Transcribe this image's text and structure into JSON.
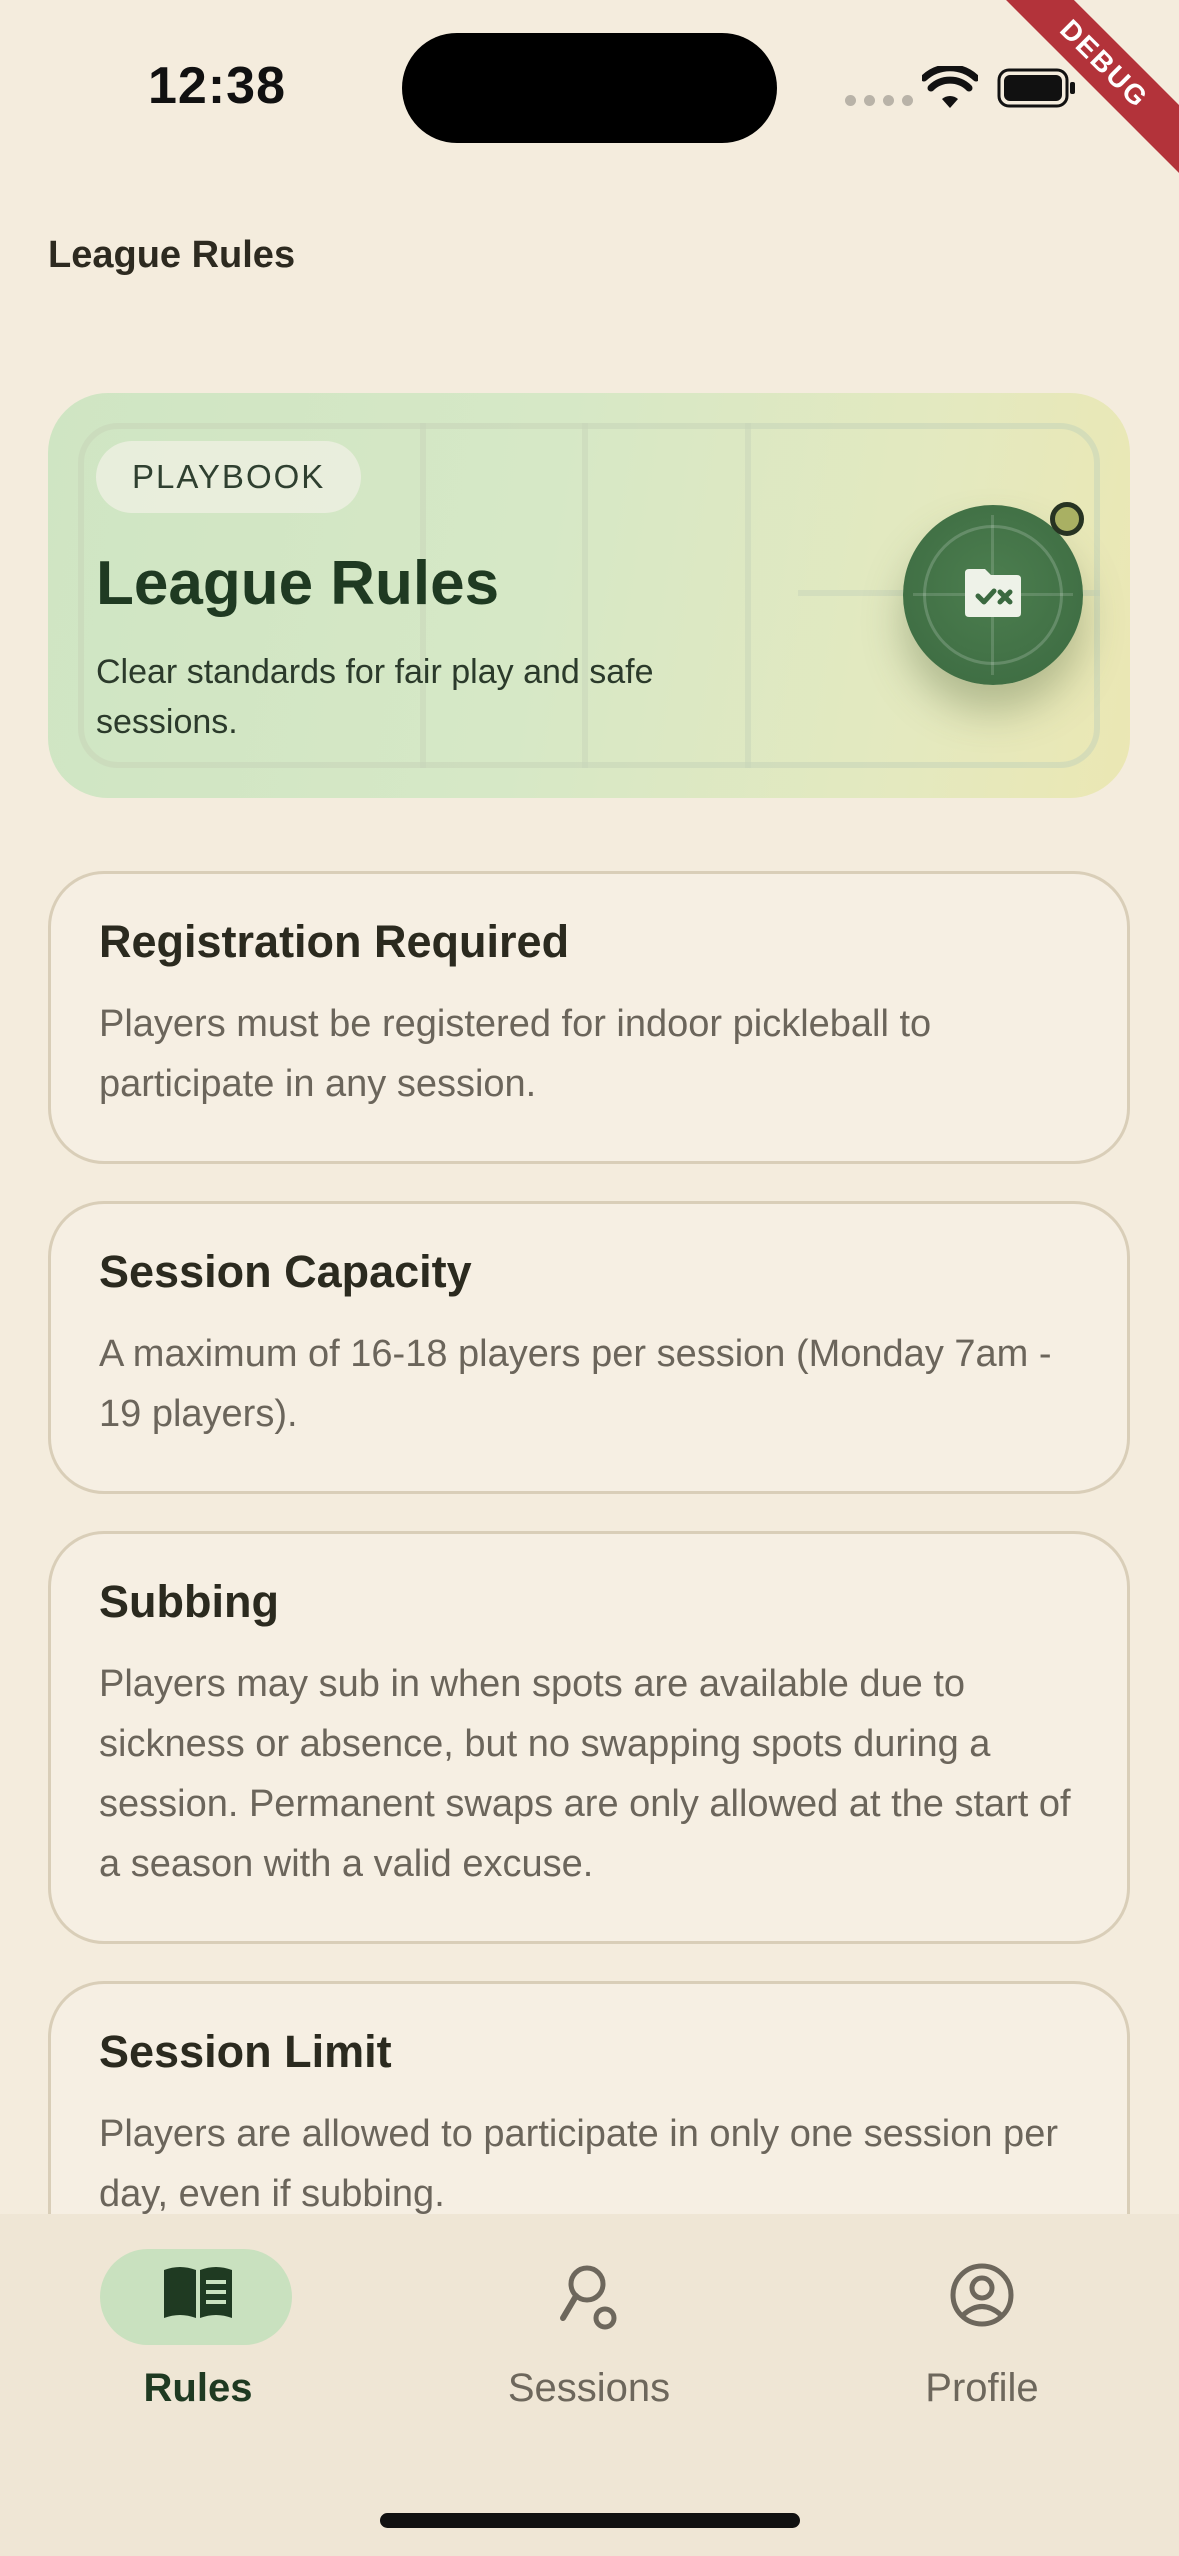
{
  "status_bar": {
    "time": "12:38"
  },
  "debug_banner": "DEBUG",
  "page": {
    "title": "League Rules"
  },
  "hero": {
    "tag": "PLAYBOOK",
    "title": "League Rules",
    "subtitle": "Clear standards for fair play and safe sessions.",
    "icon": "folder-check-x-icon"
  },
  "rules": [
    {
      "title": "Registration Required",
      "body": "Players must be registered for indoor pickleball to participate in any session."
    },
    {
      "title": "Session Capacity",
      "body": "A maximum of 16-18 players per session (Monday 7am - 19 players)."
    },
    {
      "title": "Subbing",
      "body": "Players may sub in when spots are available due to sickness or absence, but no swapping spots during a session. Permanent swaps are only allowed at the start of a season with a valid excuse."
    },
    {
      "title": "Session Limit",
      "body": "Players are allowed to participate in only one session per day, even if subbing."
    }
  ],
  "nav": {
    "items": [
      {
        "label": "Rules",
        "icon": "book-icon",
        "active": true
      },
      {
        "label": "Sessions",
        "icon": "paddle-icon",
        "active": false
      },
      {
        "label": "Profile",
        "icon": "account-circle-icon",
        "active": false
      }
    ]
  },
  "colors": {
    "background": "#f4ecdd",
    "accent_green": "#1f3a22",
    "active_pill": "#c9e1bf",
    "card_border": "#d9ceb8"
  }
}
